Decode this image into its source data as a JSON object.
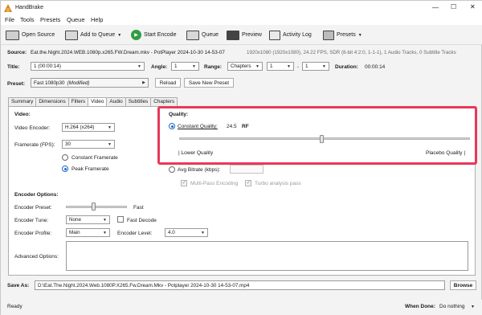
{
  "window": {
    "title": "HandBrake",
    "min": "—",
    "max": "☐",
    "close": "✕"
  },
  "menu": [
    "File",
    "Tools",
    "Presets",
    "Queue",
    "Help"
  ],
  "toolbar": {
    "open_source": "Open Source",
    "add_to_queue": "Add to Queue",
    "start_encode": "Start Encode",
    "queue": "Queue",
    "preview": "Preview",
    "activity_log": "Activity Log",
    "presets": "Presets"
  },
  "source": {
    "label": "Source:",
    "file": "Eat.the.Night.2024.WEB.1080p.x265.FW.Dream.mkv - PotPlayer 2024-10-30 14-53-07",
    "info": "1920x1080 (1920x1080), 24.22 FPS, SDR (8-bit 4:2:0, 1-1-1), 1 Audio Tracks, 0 Subtitle Tracks"
  },
  "title_row": {
    "title_label": "Title:",
    "title_value": "1 (00:00:14)",
    "angle_label": "Angle:",
    "angle_value": "1",
    "range_label": "Range:",
    "range_type": "Chapters",
    "range_from": "1",
    "range_sep": "-",
    "range_to": "1",
    "duration_label": "Duration:",
    "duration_value": "00:00:14"
  },
  "preset": {
    "label": "Preset:",
    "name": "Fast 1080p30",
    "modified": "(Modified)",
    "reload": "Reload",
    "save_new": "Save New Preset"
  },
  "tabs": [
    "Summary",
    "Dimensions",
    "Filters",
    "Video",
    "Audio",
    "Subtitles",
    "Chapters"
  ],
  "active_tab": "Video",
  "video": {
    "section": "Video:",
    "encoder_label": "Video Encoder:",
    "encoder_value": "H.264 (x264)",
    "framerate_label": "Framerate (FPS):",
    "framerate_value": "30",
    "constant_framerate": "Constant Framerate",
    "peak_framerate": "Peak Framerate"
  },
  "quality": {
    "section": "Quality:",
    "constant_quality": "Constant Quality:",
    "value": "24.5",
    "unit": "RF",
    "slider_level": 0.49,
    "lower": "| Lower Quality",
    "higher": "Placebo Quality |",
    "avg_bitrate": "Avg Bitrate (kbps):",
    "multipass": "Multi-Pass Encoding",
    "turbo": "Turbo analysis pass"
  },
  "encoder_options": {
    "section": "Encoder Options:",
    "preset_label": "Encoder Preset:",
    "preset_value": "Fast",
    "preset_level": 0.45,
    "tune_label": "Encoder Tune:",
    "tune_value": "None",
    "fast_decode": "Fast Decode",
    "profile_label": "Encoder Profile:",
    "profile_value": "Main",
    "level_label": "Encoder Level:",
    "level_value": "4.0",
    "advanced_label": "Advanced Options:"
  },
  "save": {
    "label": "Save As:",
    "path": "D:\\Eat.The.Night.2024.Web.1080P.X265.Fw.Dream.Mkv - Potplayer 2024-10-30 14-53-07.mp4",
    "browse": "Browse"
  },
  "status": {
    "ready": "Ready",
    "when_done_label": "When Done:",
    "when_done_value": "Do nothing"
  },
  "highlight_color": "#e8385a"
}
